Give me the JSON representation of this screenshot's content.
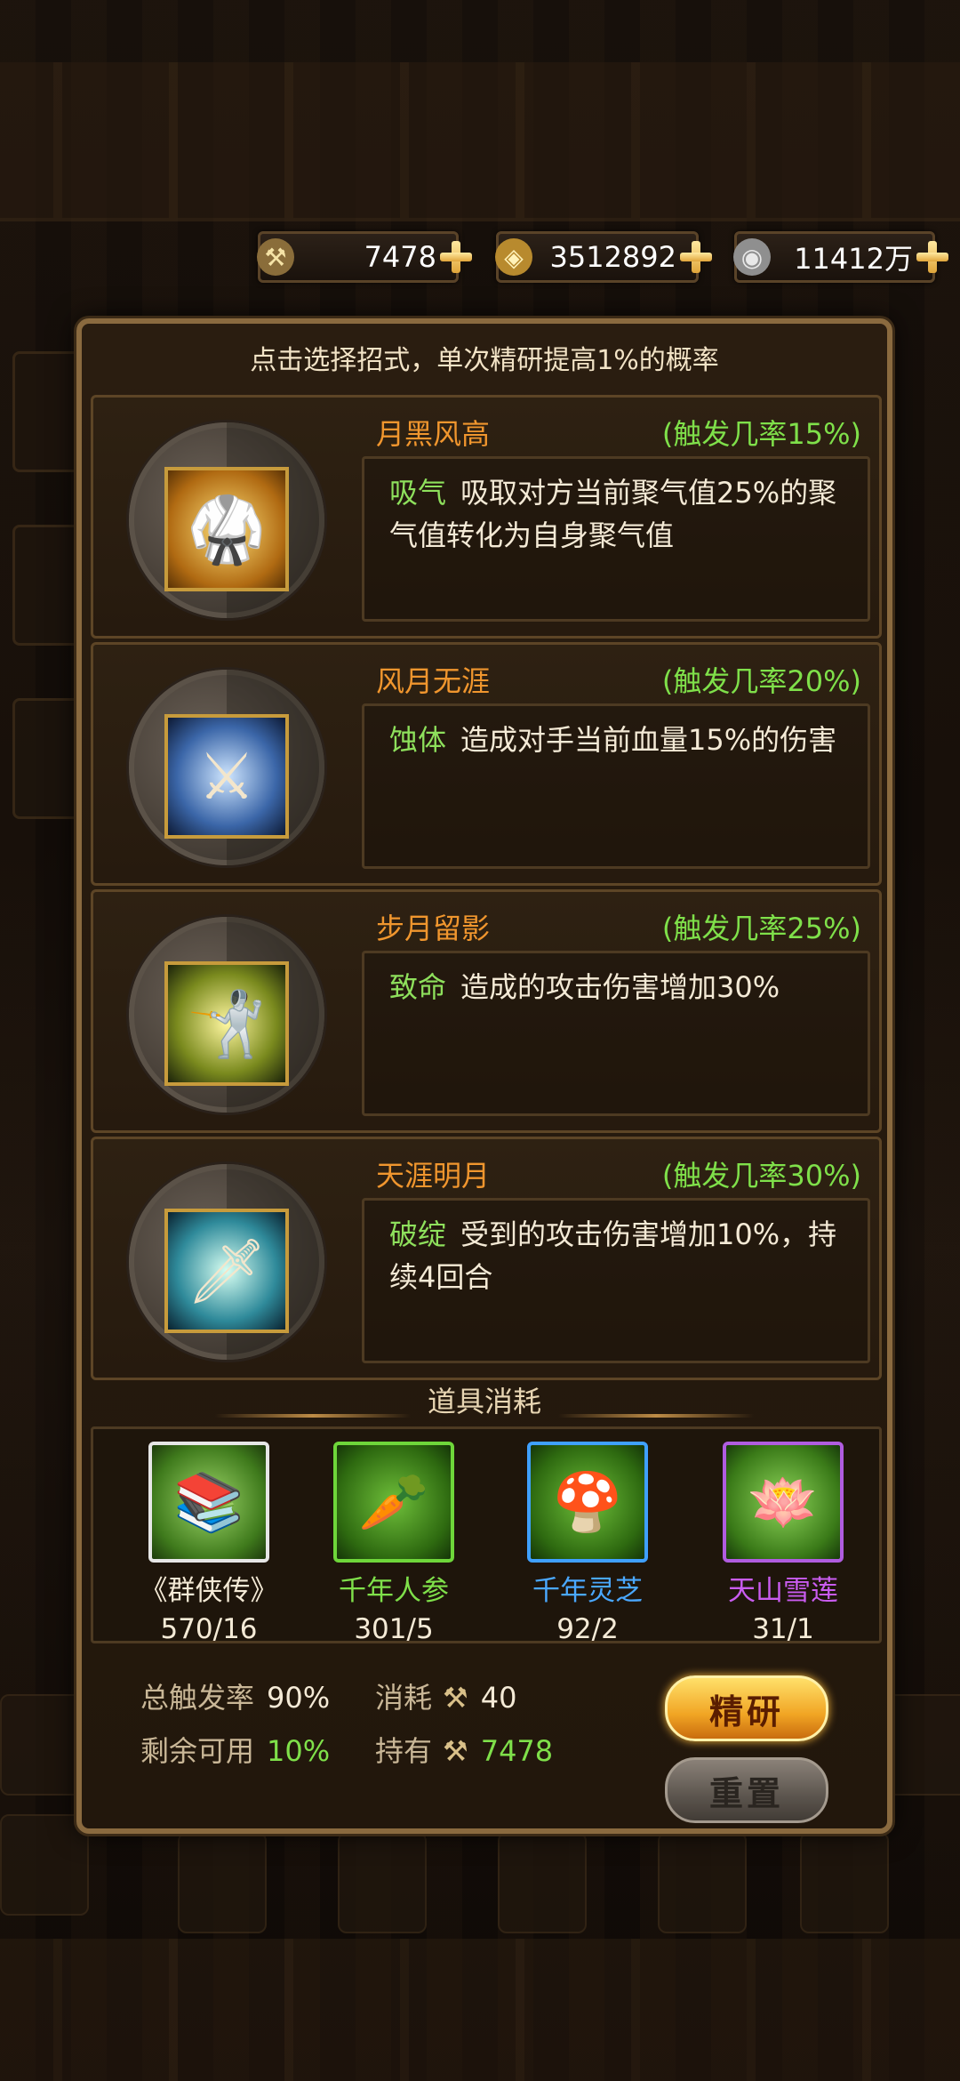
{
  "currency": [
    {
      "icon": "scroll-hammer-icon",
      "value": "7478"
    },
    {
      "icon": "gold-coin-icon",
      "value": "3512892"
    },
    {
      "icon": "silver-ingot-icon",
      "value": "11412万"
    }
  ],
  "dialog": {
    "header": "点击选择招式，单次精研提高1%的概率",
    "skills": [
      {
        "name": "月黑风高",
        "rate": "(触发几率15%)",
        "keyword": "吸气",
        "desc": "吸取对方当前聚气值25%的聚气值转化为自身聚气值",
        "icon": "martial-artist-icon"
      },
      {
        "name": "风月无涯",
        "rate": "(触发几率20%)",
        "keyword": "蚀体",
        "desc": "造成对手当前血量15%的伤害",
        "icon": "swordsman-icon"
      },
      {
        "name": "步月留影",
        "rate": "(触发几率25%)",
        "keyword": "致命",
        "desc": "造成的攻击伤害增加30%",
        "icon": "fighter-icon"
      },
      {
        "name": "天涯明月",
        "rate": "(触发几率30%)",
        "keyword": "破绽",
        "desc": "受到的攻击伤害增加10%，持续4回合",
        "icon": "blade-dancer-icon"
      }
    ],
    "items_title": "道具消耗",
    "items": [
      {
        "name": "《群侠传》",
        "count": "570/16",
        "color": "#f4ead6",
        "icon": "book-stack-icon"
      },
      {
        "name": "千年人参",
        "count": "301/5",
        "color": "#7fe04a",
        "icon": "ginseng-icon"
      },
      {
        "name": "千年灵芝",
        "count": "92/2",
        "color": "#4aa8ff",
        "icon": "lingzhi-mushroom-icon"
      },
      {
        "name": "天山雪莲",
        "count": "31/1",
        "color": "#c95cf0",
        "icon": "snow-lotus-icon"
      }
    ],
    "stats": {
      "total_rate_label": "总触发率",
      "total_rate": "90%",
      "cost_label": "消耗",
      "cost": "40",
      "remain_label": "剩余可用",
      "remain": "10%",
      "own_label": "持有",
      "own": "7478"
    },
    "buttons": {
      "research": "精研",
      "reset": "重置"
    }
  }
}
